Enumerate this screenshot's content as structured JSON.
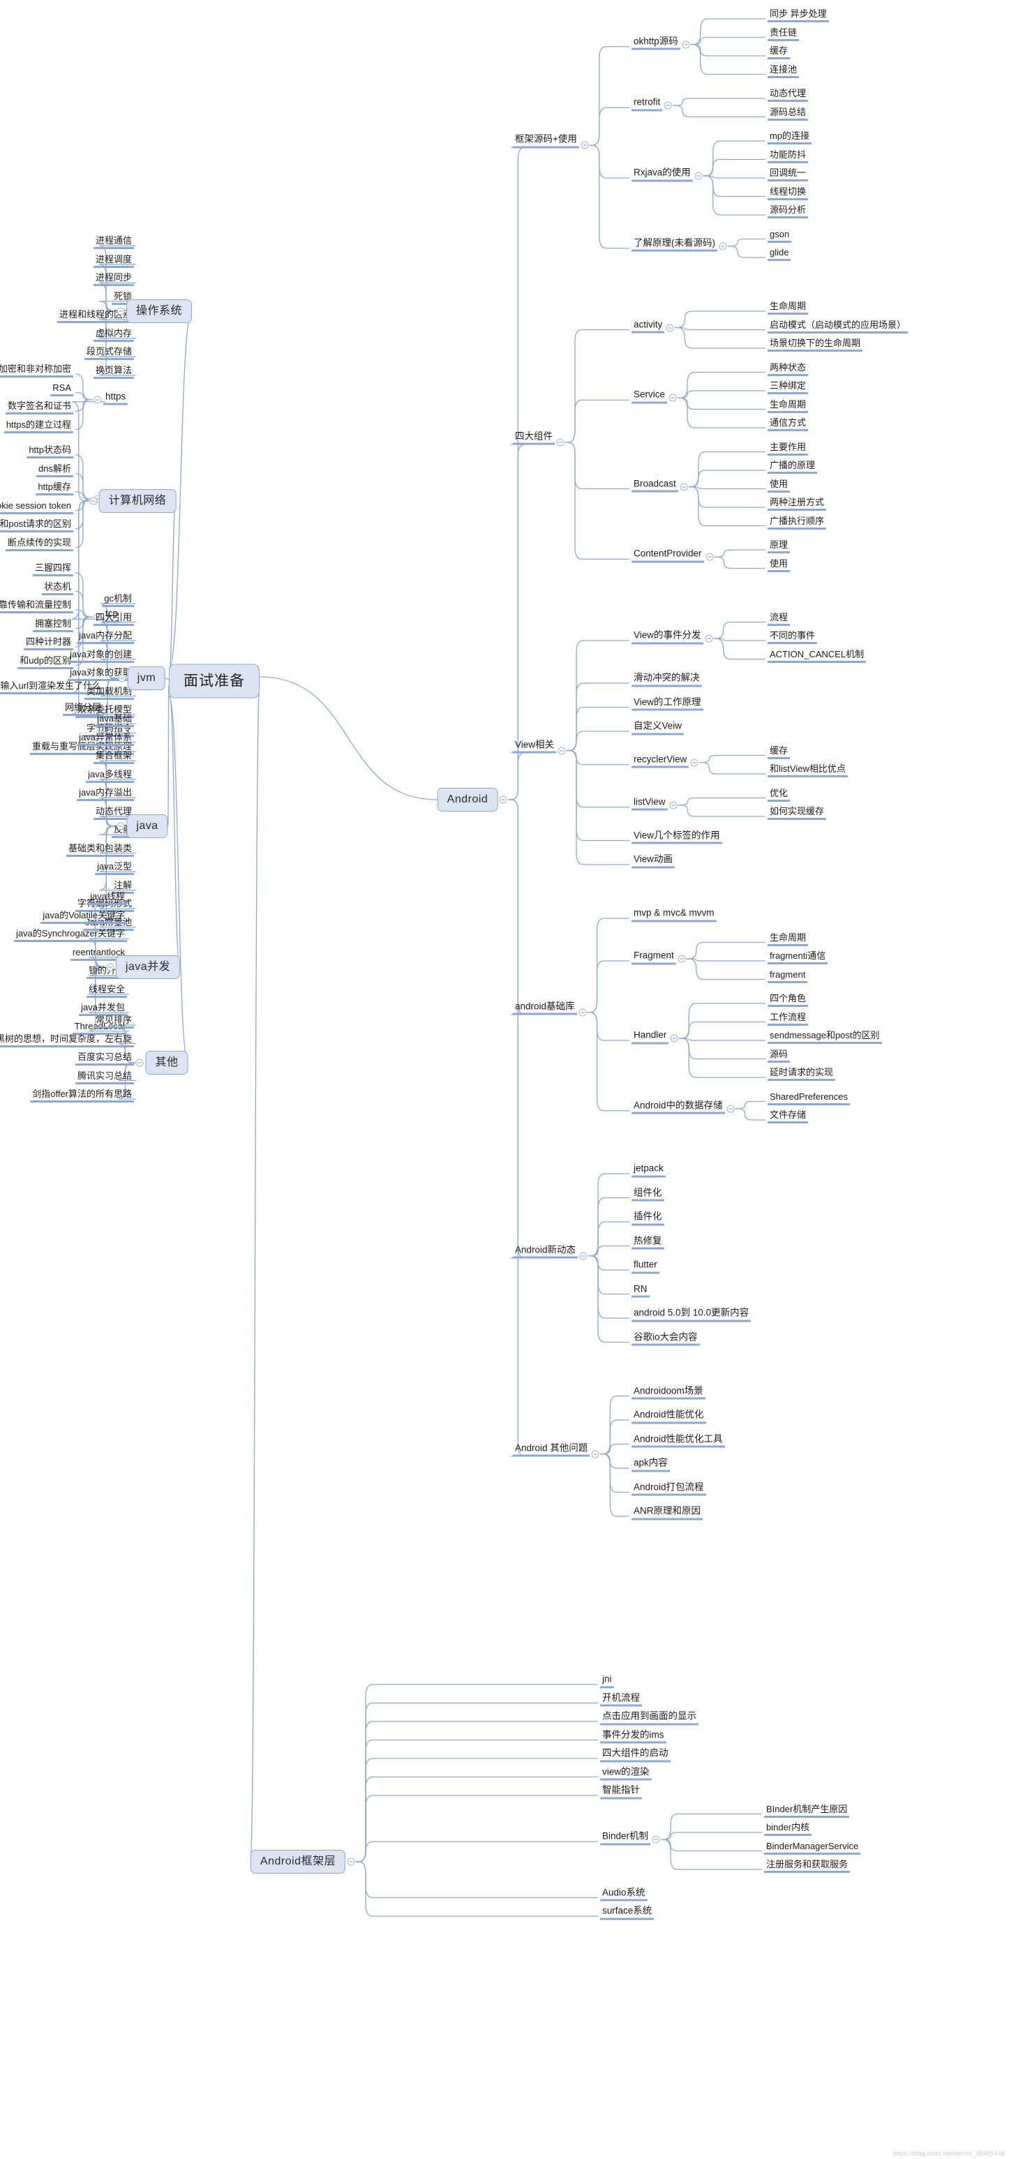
{
  "root": {
    "label": "面试准备"
  },
  "watermark": "https://blog.csdn.net/weixin_38485448",
  "colors": {
    "node_fill": "#dce4f2",
    "node_border": "#8aa9d6",
    "link": "#8aa9d6",
    "text": "#1b1b1b"
  },
  "topics": {
    "android": "Android",
    "android_framework": "Android框架层",
    "os": "操作系统",
    "network": "计算机网络",
    "jvm": "jvm",
    "java": "java",
    "java_concurrency": "java并发",
    "other": "其他"
  },
  "android": {
    "branches": [
      {
        "label": "框架源码+使用",
        "children": [
          {
            "label": "okhttp源码",
            "children": [
              "同步 异步处理",
              "责任链",
              "缓存",
              "连接池"
            ]
          },
          {
            "label": "retrofit",
            "children": [
              "动态代理",
              "源码总结"
            ]
          },
          {
            "label": "Rxjava的使用",
            "children": [
              "mp的连接",
              "功能防抖",
              "回调统一",
              "线程切换",
              "源码分析"
            ]
          },
          {
            "label": "了解原理(未看源码)",
            "children": [
              "gson",
              "glide"
            ]
          }
        ]
      },
      {
        "label": "四大组件",
        "children": [
          {
            "label": "activity",
            "children": [
              "生命周期",
              "启动模式（启动模式的应用场景）",
              "场景切换下的生命周期"
            ]
          },
          {
            "label": "Service",
            "children": [
              "两种状态",
              "三种绑定",
              "生命周期",
              "通信方式"
            ]
          },
          {
            "label": "Broadcast",
            "children": [
              "主要作用",
              "广播的原理",
              "使用",
              "两种注册方式",
              "广播执行顺序"
            ]
          },
          {
            "label": "ContentProvider",
            "children": [
              "原理",
              "使用"
            ]
          }
        ]
      },
      {
        "label": "View相关",
        "children": [
          {
            "label": "View的事件分发",
            "children": [
              "流程",
              "不同的事件",
              "ACTION_CANCEL机制"
            ]
          },
          {
            "label": "滑动冲突的解决",
            "children": []
          },
          {
            "label": "View的工作原理",
            "children": []
          },
          {
            "label": "自定义Veiw",
            "children": []
          },
          {
            "label": "recyclerView",
            "children": [
              "缓存",
              "和listView相比优点"
            ]
          },
          {
            "label": "listView",
            "children": [
              "优化",
              "如何实现缓存"
            ]
          },
          {
            "label": "View几个标签的作用",
            "children": []
          },
          {
            "label": "View动画",
            "children": []
          }
        ]
      },
      {
        "label": "android基础库",
        "children": [
          {
            "label": "mvp & mvc& mvvm",
            "children": []
          },
          {
            "label": "Fragment",
            "children": [
              "生命周期",
              "fragmenti通信",
              "fragment"
            ]
          },
          {
            "label": "Handler",
            "children": [
              "四个角色",
              "工作流程",
              "sendmessage和post的区别",
              "源码",
              "延时请求的实现"
            ]
          },
          {
            "label": "Android中的数据存储",
            "children": [
              "SharedPreferences",
              "文件存储"
            ]
          }
        ]
      },
      {
        "label": "Android新动态",
        "children": [
          {
            "label": "jetpack",
            "children": []
          },
          {
            "label": "组件化",
            "children": []
          },
          {
            "label": "插件化",
            "children": []
          },
          {
            "label": "热修复",
            "children": []
          },
          {
            "label": "flutter",
            "children": []
          },
          {
            "label": "RN",
            "children": []
          },
          {
            "label": "android 5.0到 10.0更新内容",
            "children": []
          },
          {
            "label": "谷歌io大会内容",
            "children": []
          }
        ]
      },
      {
        "label": "Android 其他问题",
        "children": [
          {
            "label": "Androidoom场景",
            "children": []
          },
          {
            "label": "Android性能优化",
            "children": []
          },
          {
            "label": "Android性能优化工具",
            "children": []
          },
          {
            "label": "apk内容",
            "children": []
          },
          {
            "label": "Android打包流程",
            "children": []
          },
          {
            "label": "ANR原理和原因",
            "children": []
          }
        ]
      }
    ]
  },
  "android_framework": {
    "children": [
      {
        "label": "jni",
        "children": []
      },
      {
        "label": "开机流程",
        "children": []
      },
      {
        "label": "点击应用到画面的显示",
        "children": []
      },
      {
        "label": "事件分发的ims",
        "children": []
      },
      {
        "label": "四大组件的启动",
        "children": []
      },
      {
        "label": "view的渲染",
        "children": []
      },
      {
        "label": "智能指针",
        "children": []
      },
      {
        "label": "Binder机制",
        "children": [
          "BInder机制产生原因",
          "binder内核",
          "BinderManagerService",
          "注册服务和获取服务"
        ]
      },
      {
        "label": "Audio系统",
        "children": []
      },
      {
        "label": "surface系统",
        "children": []
      }
    ]
  },
  "os": {
    "children": [
      "进程通信",
      "进程调度",
      "进程同步",
      "死锁",
      "进程和线程的区别",
      "虚拟内存",
      "段页式存储",
      "换页算法"
    ]
  },
  "network": {
    "branches": [
      {
        "label": "https",
        "children": [
          "对称加密和非对称加密",
          "RSA",
          "数字签名和证书",
          "https的建立过程"
        ]
      },
      {
        "label": "http",
        "children": [
          "http状态码",
          "dns解析",
          "http缓存",
          "cookie session token",
          "get和post请求的区别",
          "断点续传的实现"
        ]
      },
      {
        "label": "tcp",
        "children": [
          "三握四挥",
          "状态机",
          "可靠传输和流量控制",
          "拥塞控制",
          "四种计时器",
          "和udp的区别"
        ]
      },
      {
        "label": "输入url到渲染发生了什么",
        "children": []
      },
      {
        "label": "网络分层",
        "children": []
      }
    ]
  },
  "jvm": {
    "children": [
      "gc机制",
      "四大引用",
      "java内存分配",
      "java对象的创建",
      "java对象的获取",
      "类加载机制",
      "双亲委托模型",
      "字节码指令",
      "重载与重写底层实现原理"
    ]
  },
  "java": {
    "children": [
      "java基础",
      "java异常体系",
      "集合框架",
      "java多线程",
      "java内存溢出",
      "动态代理",
      "反射",
      "基础类和包装类",
      "java泛型",
      "注解",
      "字符编码形式",
      "Java常量池"
    ]
  },
  "java_concurrency": {
    "children": [
      "java线程",
      "java的Volatile关键字",
      "java的Synchrogazer关键字",
      "reentrantlock",
      "锁的升级",
      "线程安全",
      "java并发包",
      "ThreadLocal"
    ]
  },
  "other": {
    "children": [
      "常见排序",
      "红黑树的思想，时间复杂度，左右旋",
      "百度实习总结",
      "腾讯实习总结",
      "剑指offer算法的所有思路"
    ]
  }
}
